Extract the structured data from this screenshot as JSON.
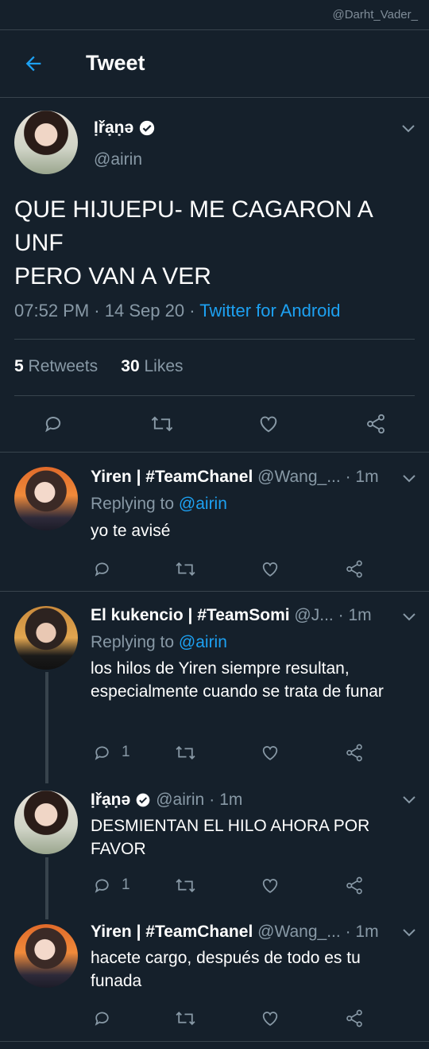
{
  "watermark": "@Darht_Vader_",
  "header": {
    "title": "Tweet"
  },
  "main_tweet": {
    "name": "Ịřạṇə",
    "handle": "@airin",
    "text_lines": [
      "QUE HIJUEPU- ME CAGARON A",
      "UNF",
      "PERO VAN A VER"
    ],
    "time": "07:52 PM",
    "date": "14 Sep 20",
    "source": "Twitter for Android",
    "retweets_count": "5",
    "retweets_label": "Retweets",
    "likes_count": "30",
    "likes_label": "Likes"
  },
  "replies": [
    {
      "name": "Yiren | #TeamChanel",
      "handle": "@Wang_...",
      "time": "1m",
      "replying_label": "Replying to",
      "replying_to": "@airin",
      "text": "yo te avisé",
      "reply_count": ""
    },
    {
      "name": "El kukencio | #TeamSomi",
      "handle": "@J...",
      "time": "1m",
      "replying_label": "Replying to",
      "replying_to": "@airin",
      "text": "los hilos de Yiren siempre resultan, especialmente cuando se trata de funar",
      "reply_count": "1"
    },
    {
      "name": "Ịřạṇə",
      "handle": "@airin",
      "time": "1m",
      "text": "DESMIENTAN EL HILO AHORA POR FAVOR",
      "reply_count": "1"
    },
    {
      "name": "Yiren | #TeamChanel",
      "handle": "@Wang_...",
      "time": "1m",
      "text": "hacete cargo, después de todo es tu funada",
      "reply_count": ""
    }
  ],
  "separator_dot": "·",
  "icons": {
    "back": "arrow-left-icon",
    "verified": "verified-badge-icon",
    "more": "chevron-down-icon",
    "reply": "comment-icon",
    "retweet": "retweet-icon",
    "like": "heart-icon",
    "share": "share-icon"
  },
  "colors": {
    "background": "#15202b",
    "accent": "#1da1f2",
    "muted": "#8899a6",
    "border": "#38444d"
  }
}
